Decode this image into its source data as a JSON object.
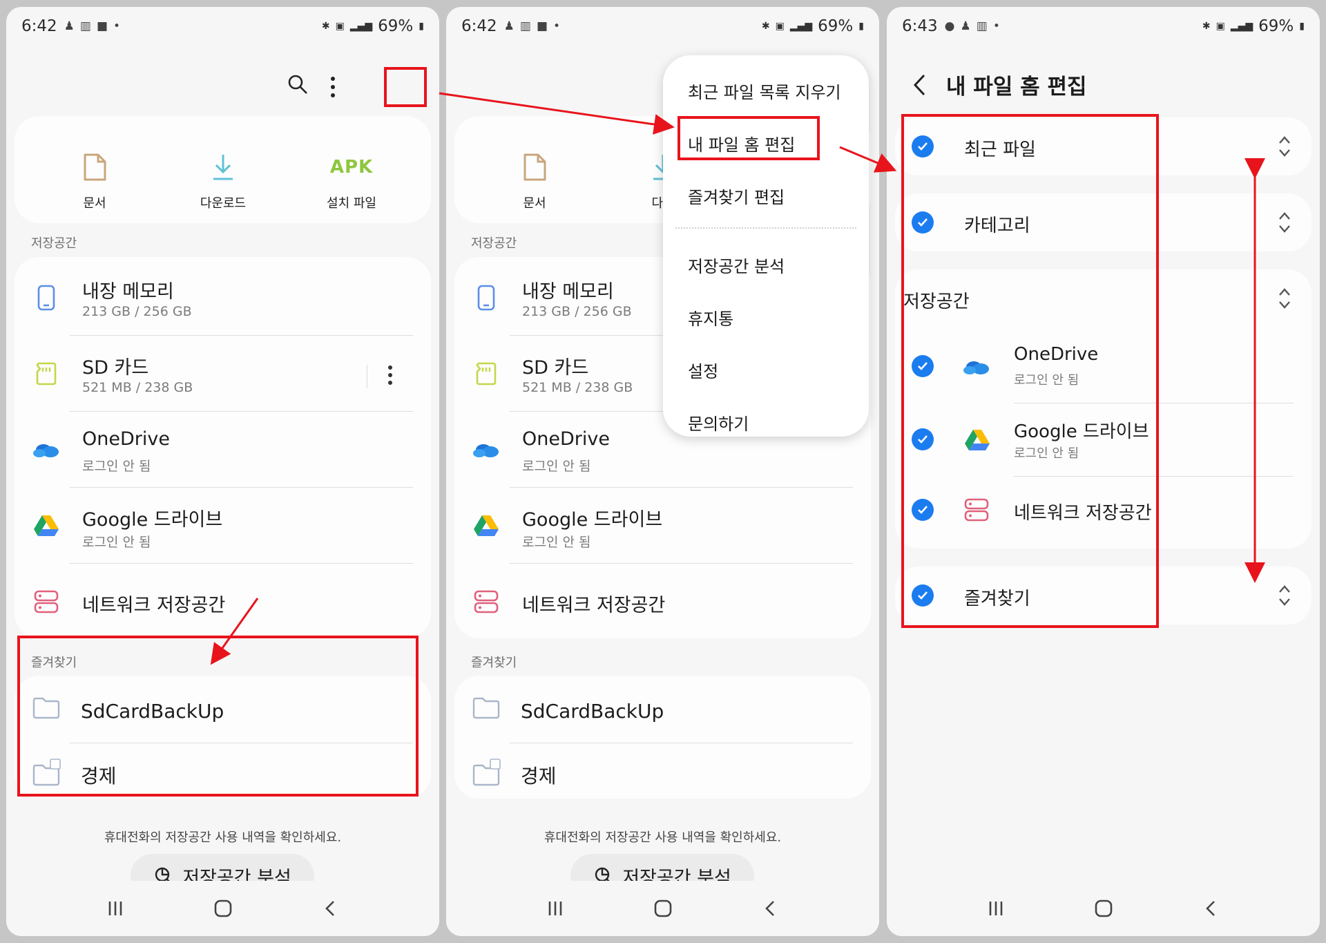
{
  "status_bar": {
    "time_a": "6:42",
    "time_b": "6:43",
    "battery": "69%"
  },
  "panel1": {
    "quick_access": [
      {
        "label": "문서",
        "icon": "document-icon"
      },
      {
        "label": "다운로드",
        "icon": "download-icon"
      },
      {
        "label": "설치 파일",
        "icon": "apk-icon",
        "badge": "APK"
      }
    ],
    "storage_label": "저장공간",
    "storage": [
      {
        "title": "내장 메모리",
        "sub": "213 GB / 256 GB",
        "icon": "phone-icon"
      },
      {
        "title": "SD 카드",
        "sub": "521 MB / 238 GB",
        "icon": "sd-card-icon"
      },
      {
        "title": "OneDrive",
        "sub": "로그인 안 됨",
        "icon": "onedrive-icon"
      },
      {
        "title": "Google 드라이브",
        "sub": "로그인 안 됨",
        "icon": "google-drive-icon"
      },
      {
        "title": "네트워크 저장공간",
        "icon": "network-storage-icon"
      }
    ],
    "favorites_label": "즐겨찾기",
    "favorites": [
      {
        "title": "SdCardBackUp"
      },
      {
        "title": "경제"
      }
    ],
    "hint": "휴대전화의 저장공간 사용 내역을 확인하세요.",
    "analysis_button": "저장공간 분석"
  },
  "panel2": {
    "quick_access_visible": [
      "문서",
      "다운"
    ],
    "menu": [
      "최근 파일 목록 지우기",
      "내 파일 홈 편집",
      "즐겨찾기 편집",
      "저장공간 분석",
      "휴지통",
      "설정",
      "문의하기"
    ]
  },
  "panel3": {
    "title": "내 파일 홈 편집",
    "items": {
      "recent": "최근 파일",
      "category": "카테고리",
      "storage": "저장공간",
      "onedrive": "OneDrive",
      "onedrive_sub": "로그인 안 됨",
      "gdrive": "Google 드라이브",
      "gdrive_sub": "로그인 안 됨",
      "network": "네트워크 저장공간",
      "favorites": "즐겨찾기"
    }
  },
  "colors": {
    "accent_blue": "#1b7cf0",
    "annotation_red": "#e8141c",
    "apk_green": "#8ec63f"
  }
}
